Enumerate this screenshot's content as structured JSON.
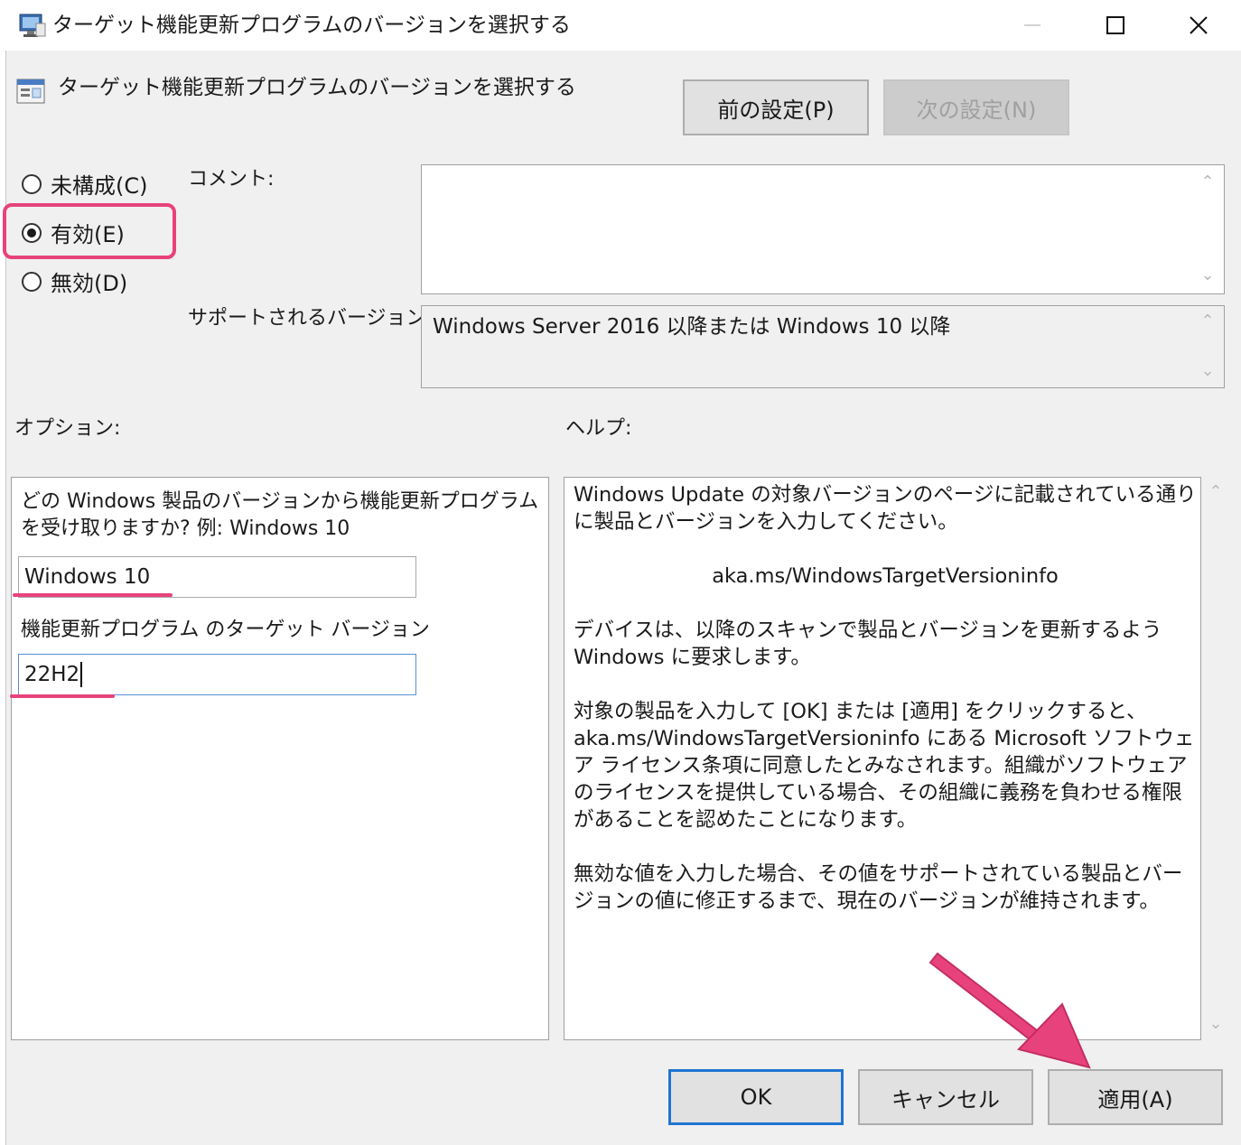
{
  "window": {
    "title": "ターゲット機能更新プログラムのバージョンを選択する",
    "header_title": "ターゲット機能更新プログラムのバージョンを選択する"
  },
  "nav": {
    "prev_label": "前の設定(P)",
    "next_label": "次の設定(N)"
  },
  "state": {
    "options": [
      {
        "label": "未構成(C)",
        "selected": false
      },
      {
        "label": "有効(E)",
        "selected": true
      },
      {
        "label": "無効(D)",
        "selected": false
      }
    ]
  },
  "comment": {
    "label": "コメント:",
    "value": ""
  },
  "supported": {
    "label": "サポートされるバージョン:",
    "value": "Windows Server 2016 以降または Windows 10 以降"
  },
  "options_section": {
    "label": "オプション:",
    "product_question": "どの Windows 製品のバージョンから機能更新プログラムを受け取りますか? 例: Windows 10",
    "product_value": "Windows 10",
    "version_label": "機能更新プログラム のターゲット バージョン",
    "version_value": "22H2"
  },
  "help": {
    "label": "ヘルプ:",
    "paragraphs": [
      "Windows Update の対象バージョンのページに記載されている通りに製品とバージョンを入力してください。",
      "aka.ms/WindowsTargetVersioninfo",
      "デバイスは、以降のスキャンで製品とバージョンを更新するよう Windows に要求します。",
      "対象の製品を入力して [OK] または [適用] をクリックすると、aka.ms/WindowsTargetVersioninfo にある Microsoft ソフトウェア ライセンス条項に同意したとみなされます。組織がソフトウェアのライセンスを提供している場合、その組織に義務を負わせる権限があることを認めたことになります。",
      "無効な値を入力した場合、その値をサポートされている製品とバージョンの値に修正するまで、現在のバージョンが維持されます。"
    ]
  },
  "buttons": {
    "ok_label": "OK",
    "cancel_label": "キャンセル",
    "apply_label": "適用(A)"
  },
  "annotations": {
    "highlight_color": "#e8427c"
  }
}
